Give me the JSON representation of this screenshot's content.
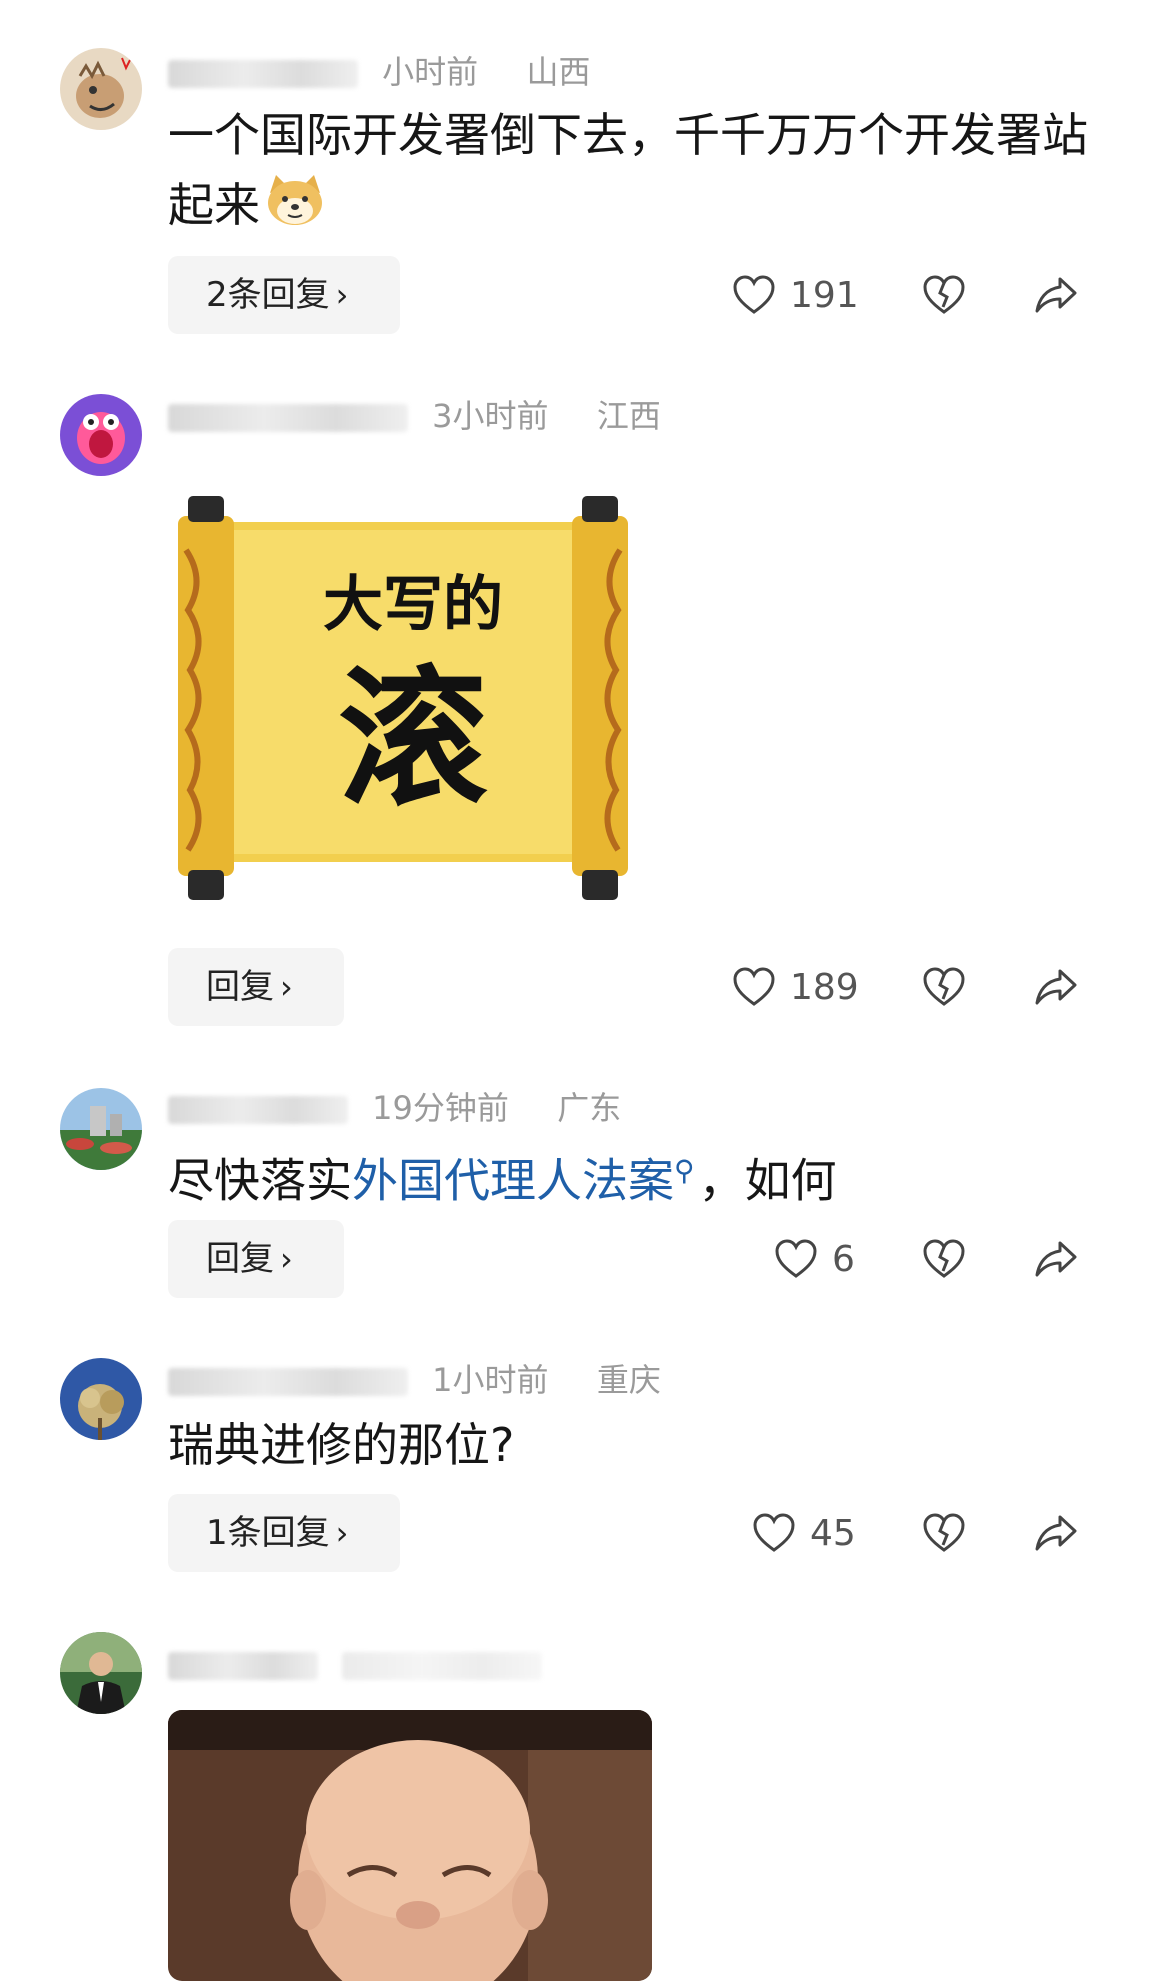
{
  "comments": [
    {
      "time": "小时前",
      "location": "山西",
      "text": "一个国际开发署倒下去，千千万万个开发署站起来",
      "reply_label": "2条回复",
      "likes": "191"
    },
    {
      "time": "3小时前",
      "location": "江西",
      "sticker_line1": "大写的",
      "sticker_line2": "滚",
      "reply_label": "回复",
      "likes": "189"
    },
    {
      "time": "19分钟前",
      "location": "广东",
      "text_before": "尽快落实",
      "text_link": "外国代理人法案",
      "text_after": "，如何",
      "reply_label": "回复",
      "likes": "6"
    },
    {
      "time": "1小时前",
      "location": "重庆",
      "text": "瑞典进修的那位?",
      "reply_label": "1条回复",
      "likes": "45"
    }
  ],
  "icons": {
    "like": "heart-outline-icon",
    "dislike": "broken-heart-icon",
    "share": "share-arrow-icon",
    "chevron": "chevron-right-icon",
    "search": "search-icon"
  },
  "colors": {
    "link": "#1f5fa8",
    "meta": "#9a9a9a",
    "button_bg": "#f4f4f4"
  }
}
